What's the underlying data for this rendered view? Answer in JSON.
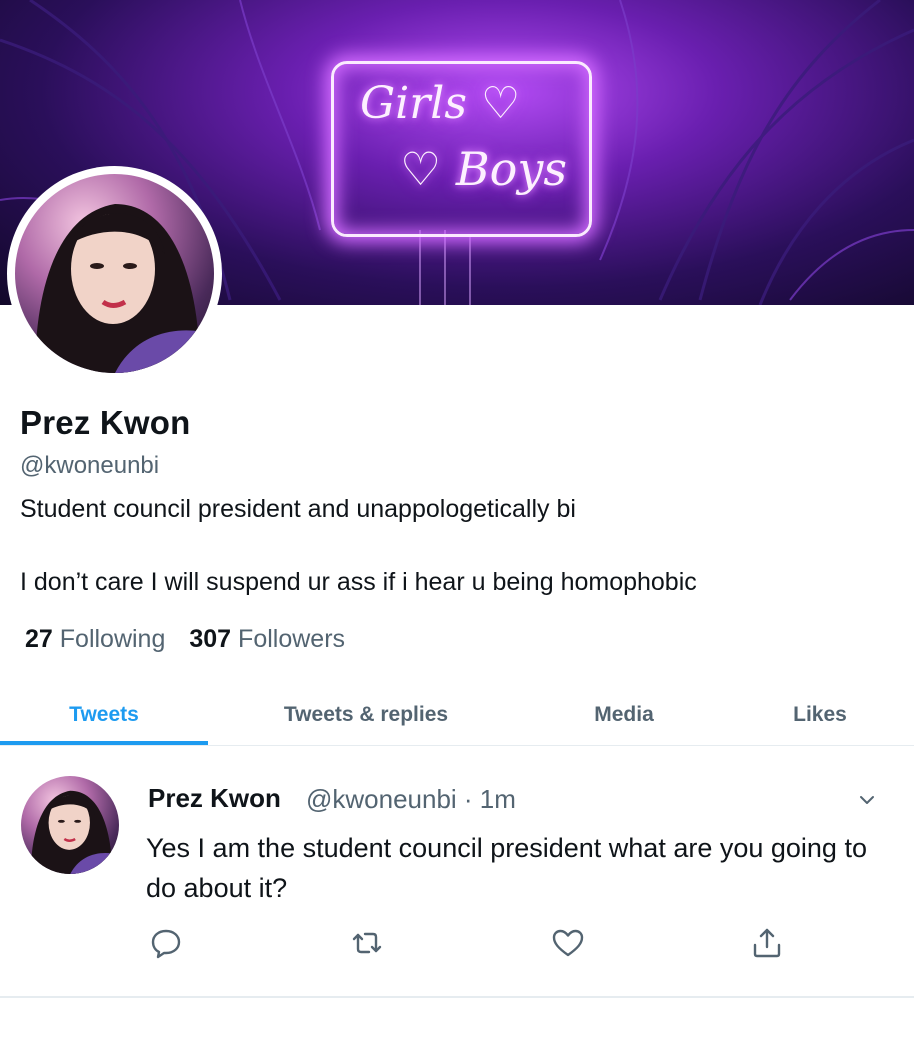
{
  "banner": {
    "neon_line1": "Girls ♡",
    "neon_line2": "♡ Boys"
  },
  "profile": {
    "name": "Prez Kwon",
    "handle": "@kwoneunbi",
    "bio_line1": "Student council president and unappologetically bi",
    "bio_line2": "I don’t care I will suspend ur ass if i hear u being homophobic",
    "following_count": "27",
    "following_label": "Following",
    "followers_count": "307",
    "followers_label": "Followers"
  },
  "tabs": [
    {
      "label": "Tweets",
      "active": true
    },
    {
      "label": "Tweets & replies",
      "active": false
    },
    {
      "label": "Media",
      "active": false
    },
    {
      "label": "Likes",
      "active": false
    }
  ],
  "tweet": {
    "author_name": "Prez Kwon",
    "meta": "@kwoneunbi · 1m",
    "text": "Yes I am the student council president what are you going to do about it?",
    "actions": [
      "reply-icon",
      "retweet-icon",
      "like-icon",
      "share-icon"
    ]
  },
  "colors": {
    "accent": "#1d9bf0",
    "secondary_text": "#536471",
    "neon_purple": "#c04bff"
  }
}
